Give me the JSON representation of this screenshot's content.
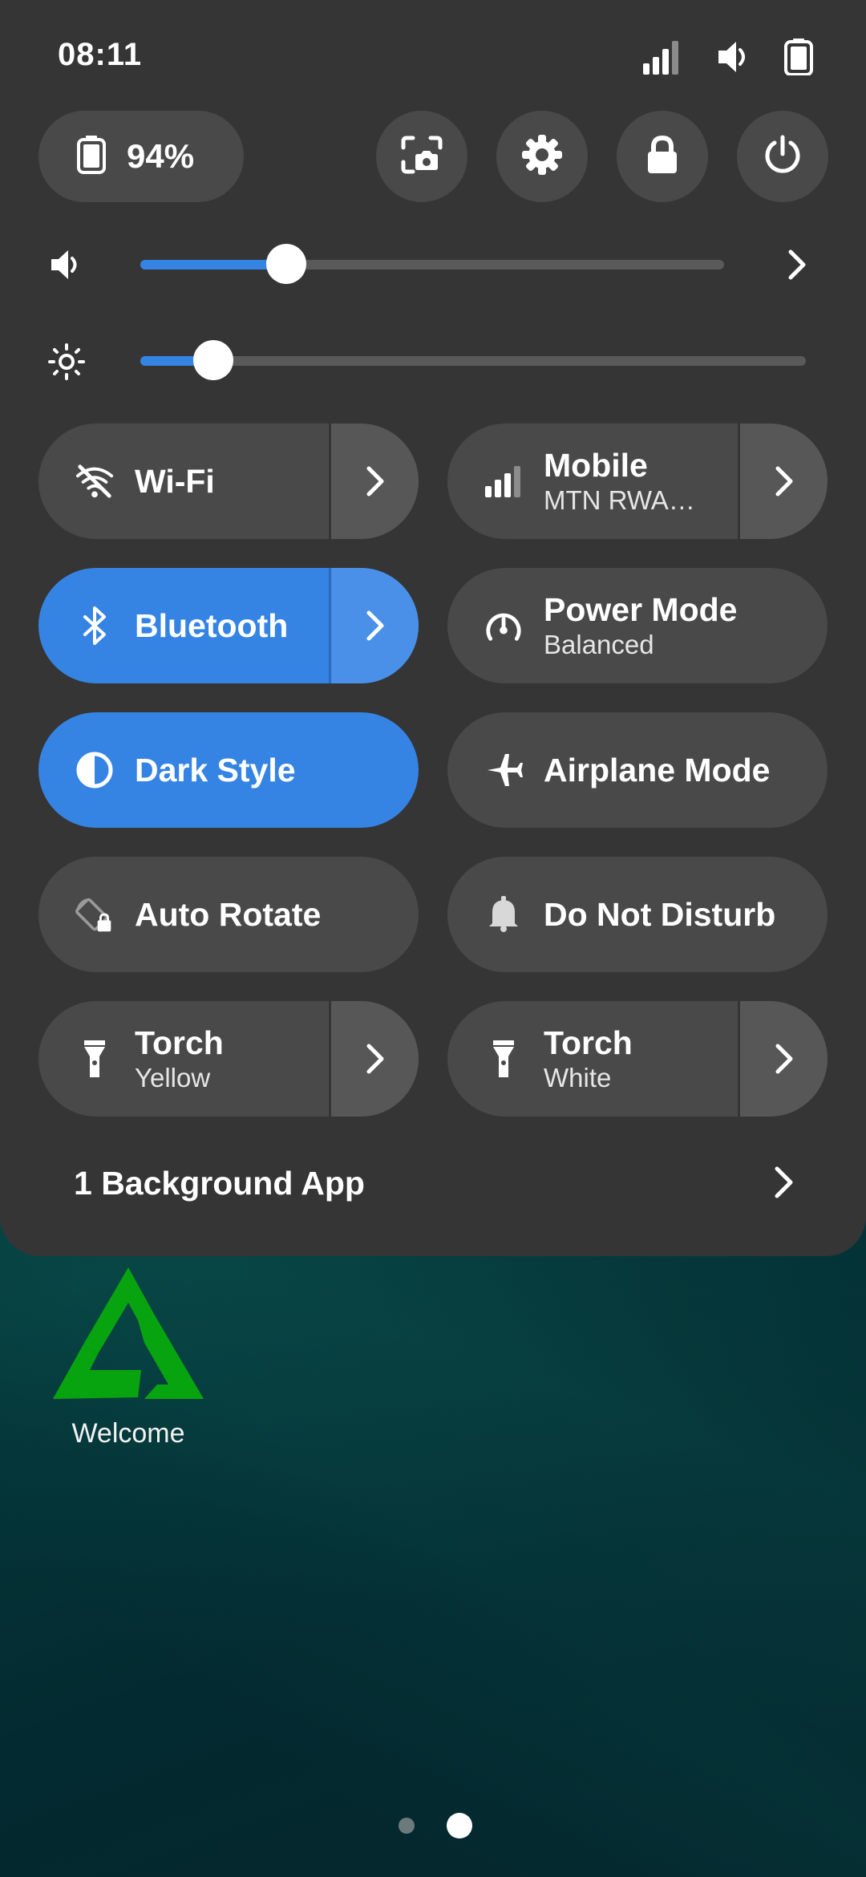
{
  "status_bar": {
    "time": "08:11",
    "icons": [
      "signal-icon",
      "volume-icon",
      "battery-icon"
    ]
  },
  "quick_actions": {
    "battery_percent": "94%",
    "buttons": [
      "screenshot-icon",
      "settings-icon",
      "lock-icon",
      "power-icon"
    ]
  },
  "sliders": {
    "volume": {
      "icon": "volume-icon",
      "level": 0.25
    },
    "brightness": {
      "icon": "brightness-icon",
      "level": 0.11
    }
  },
  "tiles": {
    "wifi": {
      "title": "Wi-Fi",
      "icon": "wifi-off-icon",
      "active": false
    },
    "mobile": {
      "title": "Mobile",
      "subtitle": "MTN RWA…",
      "icon": "signal-icon",
      "active": false
    },
    "bluetooth": {
      "title": "Bluetooth",
      "icon": "bluetooth-icon",
      "active": true
    },
    "power_mode": {
      "title": "Power Mode",
      "subtitle": "Balanced",
      "icon": "power-mode-icon",
      "active": false
    },
    "dark_style": {
      "title": "Dark Style",
      "icon": "dark-style-icon",
      "active": true
    },
    "airplane": {
      "title": "Airplane Mode",
      "icon": "airplane-icon",
      "active": false
    },
    "auto_rotate": {
      "title": "Auto Rotate",
      "icon": "rotation-lock-icon",
      "active": false
    },
    "dnd": {
      "title": "Do Not Disturb",
      "icon": "bell-icon",
      "active": false
    },
    "torch_yellow": {
      "title": "Torch",
      "subtitle": "Yellow",
      "icon": "torch-icon",
      "active": false
    },
    "torch_white": {
      "title": "Torch",
      "subtitle": "White",
      "icon": "torch-icon",
      "active": false
    }
  },
  "background_apps": {
    "label": "1 Background App"
  },
  "desktop": {
    "app_label": "Welcome",
    "page_count": 2,
    "current_page": 2
  },
  "colors": {
    "panel": "#353535",
    "tile": "#494949",
    "accent": "#3584e4",
    "app_icon": "#08a40f"
  }
}
